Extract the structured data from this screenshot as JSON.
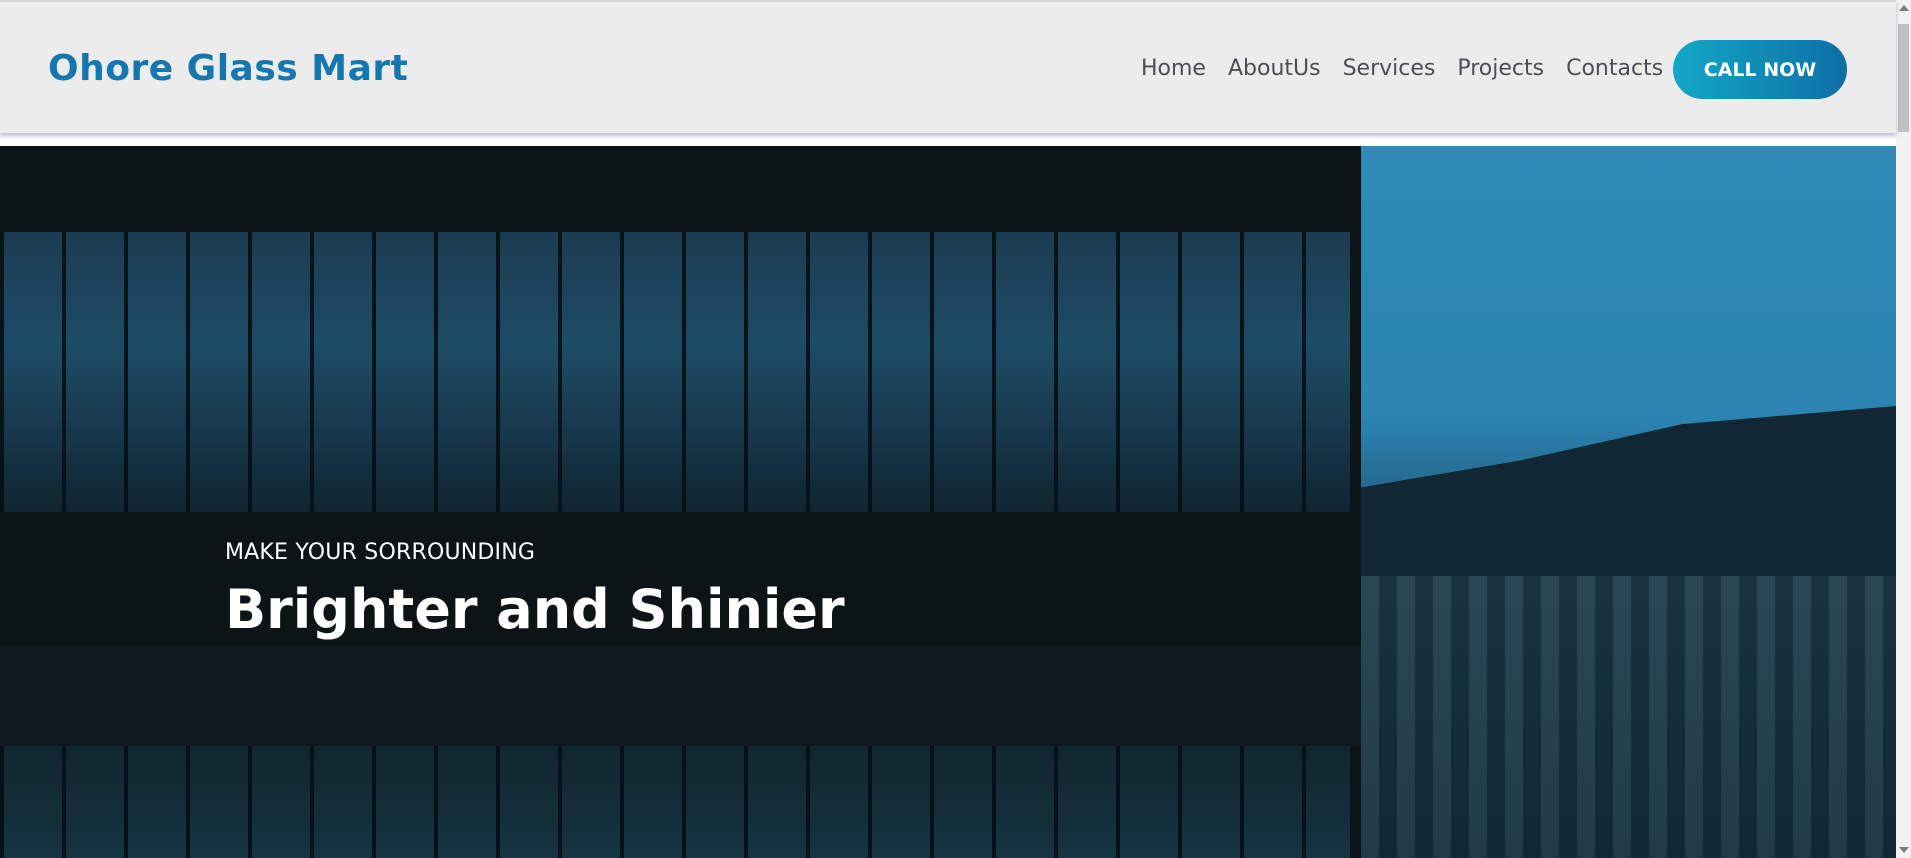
{
  "header": {
    "logo": "Ohore Glass Mart",
    "nav": [
      "Home",
      "AboutUs",
      "Services",
      "Projects",
      "Contacts"
    ],
    "cta": "CALL NOW"
  },
  "hero": {
    "subtitle": "MAKE YOUR SORROUNDING",
    "title": "Brighter and Shinier"
  },
  "colors": {
    "brand": "#1577b0",
    "cta_gradient_start": "#13a7c6",
    "cta_gradient_end": "#0d6fa6",
    "header_bg": "#ececec"
  }
}
